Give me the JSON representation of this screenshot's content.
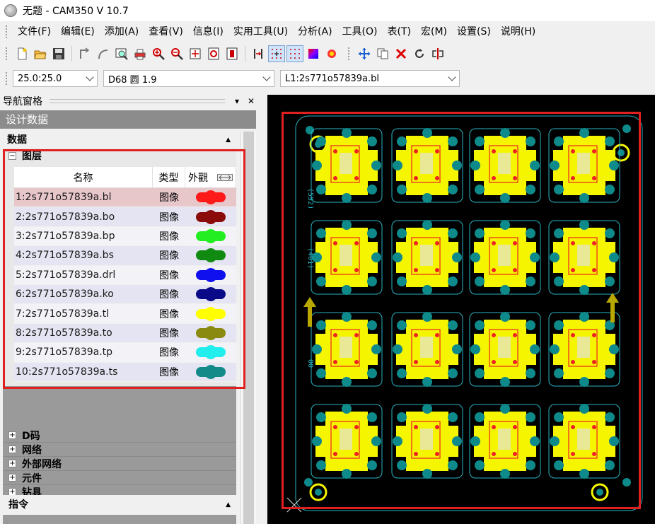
{
  "window": {
    "title": "无题 - CAM350 V 10.7"
  },
  "menu": [
    "文件(F)",
    "编辑(E)",
    "添加(A)",
    "查看(V)",
    "信息(I)",
    "实用工具(U)",
    "分析(A)",
    "工具(O)",
    "表(T)",
    "宏(M)",
    "设置(S)",
    "说明(H)"
  ],
  "toolbar": {
    "icons": [
      "new-file-icon",
      "open-folder-icon",
      "save-icon",
      "undo-icon",
      "redo-icon",
      "zoom-window-icon",
      "print-icon",
      "zoom-in-icon",
      "zoom-out-icon",
      "zoom-all-icon",
      "redraw-icon",
      "layer-icon",
      "grid-snap-icon",
      "grid-icon",
      "grid-dots-icon",
      "color-icon",
      "flash-icon",
      "move-icon",
      "copy-icon",
      "delete-icon",
      "rotate-icon",
      "mirror-icon"
    ]
  },
  "combos": {
    "grid": "25.0:25.0",
    "dcode": "D68  圆 1.9",
    "layer": "L1:2s771o57839a.bl"
  },
  "nav": {
    "title": "导航窗格",
    "section_title": "设计数据",
    "data_label": "数据",
    "layers_label": "图层",
    "columns": {
      "name": "名称",
      "type": "类型",
      "look": "外觀"
    },
    "layers": [
      {
        "name": "1:2s771o57839a.bl",
        "type": "图像",
        "color": "#ff1a1a"
      },
      {
        "name": "2:2s771o57839a.bo",
        "type": "图像",
        "color": "#8b0a0a"
      },
      {
        "name": "3:2s771o57839a.bp",
        "type": "图像",
        "color": "#22ee22"
      },
      {
        "name": "4:2s771o57839a.bs",
        "type": "图像",
        "color": "#108a10"
      },
      {
        "name": "5:2s771o57839a.drl",
        "type": "图像",
        "color": "#1010ee"
      },
      {
        "name": "6:2s771o57839a.ko",
        "type": "图像",
        "color": "#0a0a88"
      },
      {
        "name": "7:2s771o57839a.tl",
        "type": "图像",
        "color": "#ffff00"
      },
      {
        "name": "8:2s771o57839a.to",
        "type": "图像",
        "color": "#8a8a10"
      },
      {
        "name": "9:2s771o57839a.tp",
        "type": "图像",
        "color": "#22eeee"
      },
      {
        "name": "10:2s771o57839a.ts",
        "type": "图像",
        "color": "#128a8a"
      }
    ],
    "other_nodes": [
      "D码",
      "网络",
      "外部网络",
      "元件",
      "钻具"
    ],
    "commands_label": "指令"
  },
  "canvas": {
    "labels": [
      "(592)",
      "(401)",
      "00"
    ]
  }
}
